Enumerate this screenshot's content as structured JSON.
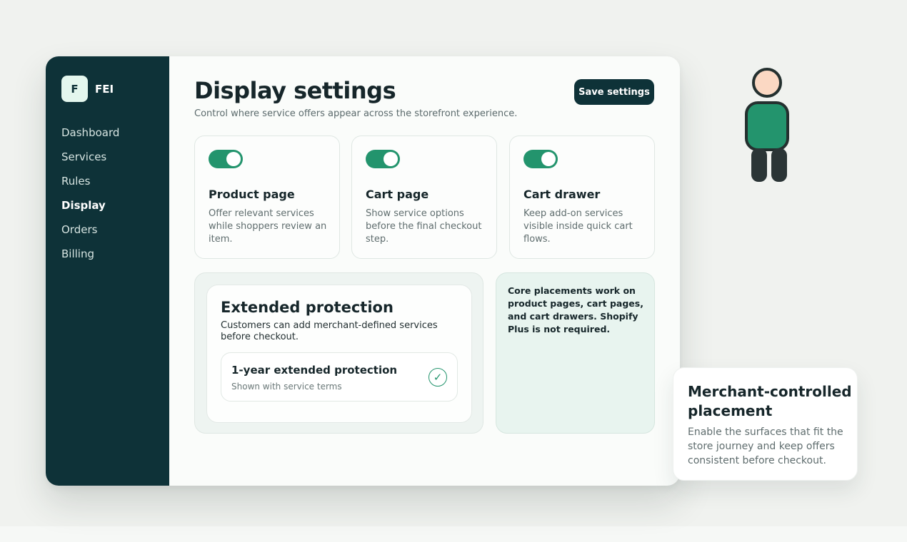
{
  "brand": {
    "logo_letter": "F",
    "name": "FEI"
  },
  "sidebar": {
    "items": [
      {
        "label": "Dashboard",
        "active": false
      },
      {
        "label": "Services",
        "active": false
      },
      {
        "label": "Rules",
        "active": false
      },
      {
        "label": "Display",
        "active": true
      },
      {
        "label": "Orders",
        "active": false
      },
      {
        "label": "Billing",
        "active": false
      }
    ]
  },
  "header": {
    "title": "Display settings",
    "subtitle": "Control where service offers appear across the storefront experience.",
    "save_label": "Save settings"
  },
  "placements": [
    {
      "title": "Product page",
      "description": "Offer relevant services while shoppers review an item.",
      "enabled": true
    },
    {
      "title": "Cart page",
      "description": "Show service options before the final checkout step.",
      "enabled": true
    },
    {
      "title": "Cart drawer",
      "description": "Keep add-on services visible inside quick cart flows.",
      "enabled": true
    }
  ],
  "preview": {
    "title": "Extended protection",
    "description": "Customers can add merchant-defined services before checkout.",
    "option": {
      "title": "1-year extended protection",
      "subtitle": "Shown with service terms",
      "check_icon": "✓"
    }
  },
  "note": {
    "text": "Core placements work on product pages, cart pages, and cart drawers. Shopify Plus is not required."
  },
  "callout": {
    "title": "Merchant-controlled placement",
    "body": "Enable the surfaces that fit the store journey and keep offers consistent before checkout."
  },
  "colors": {
    "sidebar": "#0e3238",
    "accent": "#23946d",
    "page_bg": "#f0f2ef"
  },
  "icons": [
    "person-illustration",
    "check-icon"
  ]
}
